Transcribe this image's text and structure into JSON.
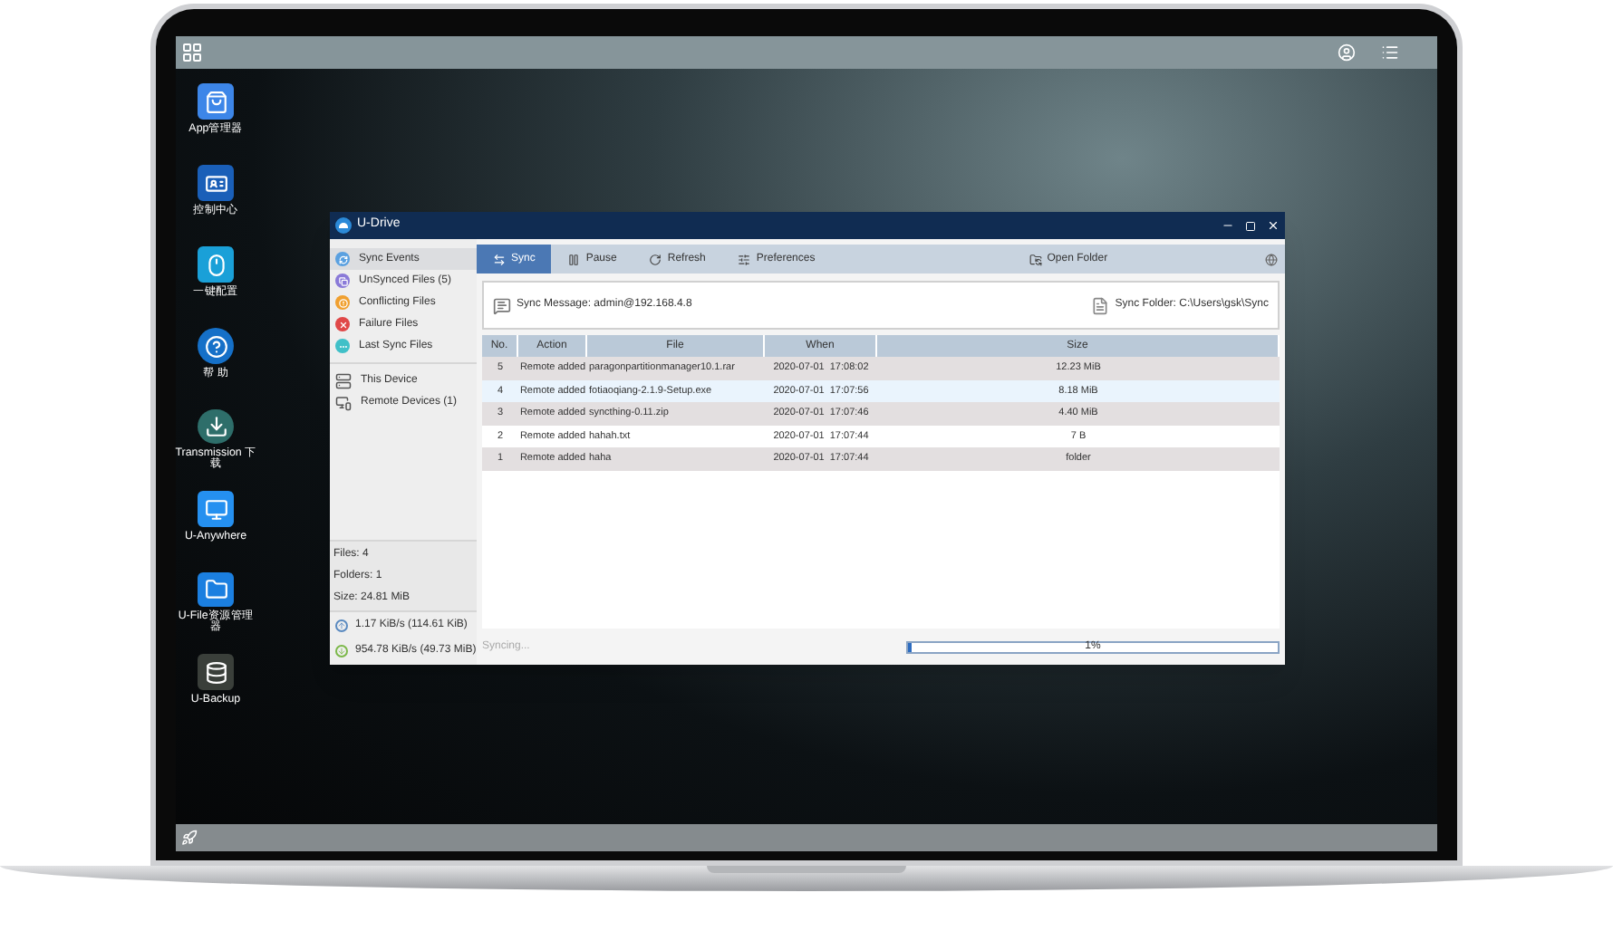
{
  "desktop_icons": [
    {
      "kind": "store",
      "label": "App管理器"
    },
    {
      "kind": "control",
      "label": "控制中心"
    },
    {
      "kind": "mouse",
      "label": "一键配置"
    },
    {
      "kind": "help",
      "label": "帮 助"
    },
    {
      "kind": "download",
      "label": "Transmission 下载"
    },
    {
      "kind": "remote",
      "label": "U-Anywhere"
    },
    {
      "kind": "folder",
      "label": "U-File资源管理器"
    },
    {
      "kind": "backup",
      "label": "U-Backup"
    }
  ],
  "window": {
    "title": "U-Drive",
    "sidebar": {
      "items": [
        {
          "kind": "sync",
          "label": "Sync Events",
          "selected": true
        },
        {
          "kind": "unsynced",
          "label": "UnSynced Files (5)",
          "selected": false
        },
        {
          "kind": "conflict",
          "label": "Conflicting Files",
          "selected": false
        },
        {
          "kind": "failure",
          "label": "Failure Files",
          "selected": false
        },
        {
          "kind": "last",
          "label": "Last Sync Files",
          "selected": false
        }
      ],
      "devices": [
        {
          "kind": "local",
          "label": "This Device",
          "selected": false
        },
        {
          "kind": "remote",
          "label": "Remote Devices (1)",
          "selected": false
        }
      ],
      "stats": [
        "Files: 4",
        "Folders: 1",
        "Size: 24.81 MiB"
      ],
      "transfers": [
        {
          "kind": "upload",
          "text": "1.17 KiB/s (114.61 KiB)"
        },
        {
          "kind": "download",
          "text": "954.78 KiB/s (49.73 MiB)"
        }
      ]
    },
    "toolbar": {
      "items": [
        {
          "kind": "sync",
          "label": "Sync",
          "selected": true
        },
        {
          "kind": "pause",
          "label": "Pause",
          "selected": false
        },
        {
          "kind": "refresh",
          "label": "Refresh",
          "selected": false
        },
        {
          "kind": "preferences",
          "label": "Preferences",
          "selected": false
        },
        {
          "kind": "open",
          "label": "Open Folder",
          "selected": false
        }
      ]
    },
    "message": "Sync Message: admin@192.168.4.8",
    "sync_folder": "Sync Folder: C:\\Users\\gsk\\Sync",
    "table": {
      "columns": [
        "No.",
        "Action",
        "File",
        "When",
        "Size"
      ],
      "rows": [
        {
          "no": "5",
          "action": "Remote added",
          "file": "paragonpartitionmanager10.1.rar",
          "when": "2020-07-01  17:08:02",
          "size": "12.23 MiB",
          "selected": false
        },
        {
          "no": "4",
          "action": "Remote added",
          "file": "fotiaoqiang-2.1.9-Setup.exe",
          "when": "2020-07-01  17:07:56",
          "size": "8.18 MiB",
          "selected": true
        },
        {
          "no": "3",
          "action": "Remote added",
          "file": "syncthing-0.11.zip",
          "when": "2020-07-01  17:07:46",
          "size": "4.40 MiB",
          "selected": false
        },
        {
          "no": "2",
          "action": "Remote added",
          "file": "hahah.txt",
          "when": "2020-07-01  17:07:44",
          "size": "7 B",
          "selected": false
        },
        {
          "no": "1",
          "action": "Remote added",
          "file": "haha",
          "when": "2020-07-01  17:07:44",
          "size": "folder",
          "selected": false
        }
      ]
    },
    "status": "Syncing...",
    "progress": {
      "level": 0.01,
      "label": "1%"
    }
  }
}
